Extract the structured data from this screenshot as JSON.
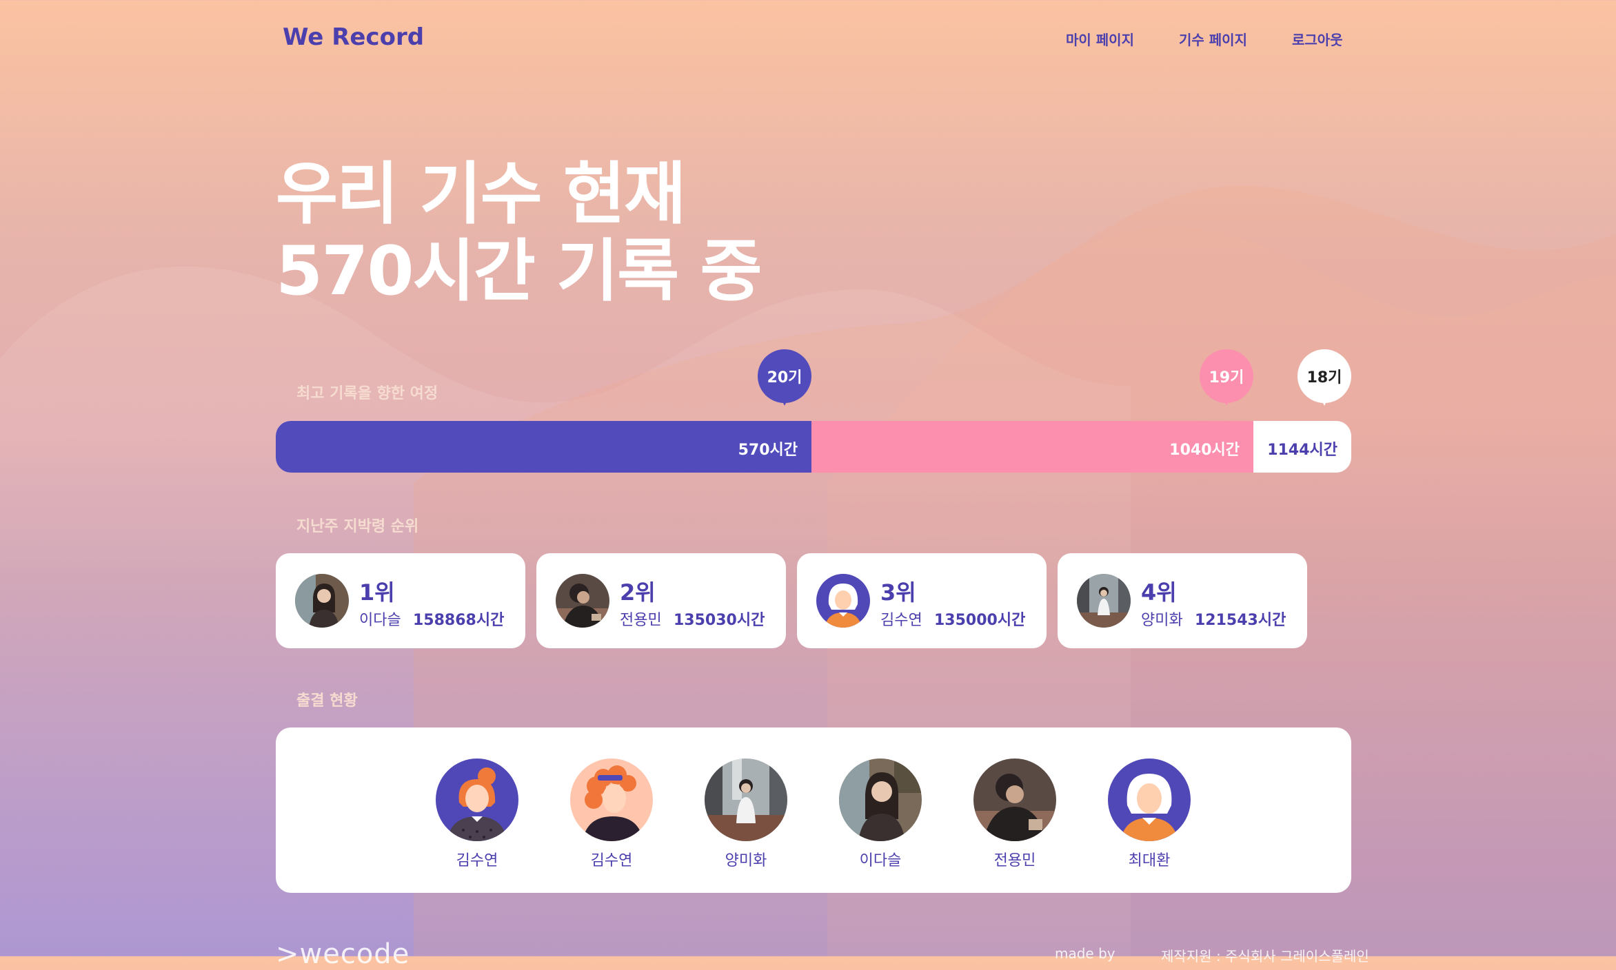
{
  "header": {
    "brand": "We Record",
    "nav": [
      "마이 페이지",
      "기수 페이지",
      "로그아웃"
    ]
  },
  "hero": {
    "line1": "우리 기수 현재",
    "line2": "570시간 기록 중"
  },
  "journey": {
    "label": "최고 기록을 향한 여정",
    "max_hours": 1144,
    "segments": [
      {
        "cohort": "20기",
        "hours": 570,
        "label": "570시간",
        "color": "#524bbc",
        "text_color": "#ffffff"
      },
      {
        "cohort": "19기",
        "hours": 1040,
        "label": "1040시간",
        "color": "#fc8fae",
        "text_color": "#ffffff"
      },
      {
        "cohort": "18기",
        "hours": 1144,
        "label": "1144시간",
        "color": "#ffffff",
        "text_color": "#4b3fae"
      }
    ]
  },
  "ranking": {
    "label": "지난주 지박령 순위",
    "items": [
      {
        "rank": "1위",
        "name": "이다슬",
        "hours": "158868시간",
        "avatar": "photo-avatar-woman-icon"
      },
      {
        "rank": "2위",
        "name": "전용민",
        "hours": "135030시간",
        "avatar": "photo-avatar-man-icon"
      },
      {
        "rank": "3위",
        "name": "김수연",
        "hours": "135000시간",
        "avatar": "illustrated-avatar-white-hair-icon"
      },
      {
        "rank": "4위",
        "name": "양미화",
        "hours": "121543시간",
        "avatar": "photo-avatar-lobby-icon"
      }
    ]
  },
  "attendance": {
    "label": "출결 현황",
    "members": [
      {
        "name": "김수연",
        "avatar": "illustrated-avatar-bun-hair-icon"
      },
      {
        "name": "김수연",
        "avatar": "illustrated-avatar-curly-hair-icon"
      },
      {
        "name": "양미화",
        "avatar": "photo-avatar-lobby-icon"
      },
      {
        "name": "이다슬",
        "avatar": "photo-avatar-woman-icon"
      },
      {
        "name": "전용민",
        "avatar": "photo-avatar-man-icon"
      },
      {
        "name": "최대환",
        "avatar": "illustrated-avatar-white-hair-icon"
      }
    ]
  },
  "footer": {
    "logo": ">wecode",
    "made_by": "made by",
    "sponsor": "제작지원 : 주식회사 그레이스풀레인"
  },
  "colors": {
    "accent": "#524bbc",
    "pink": "#fc8fae",
    "text_dark": "#4b3fae"
  }
}
